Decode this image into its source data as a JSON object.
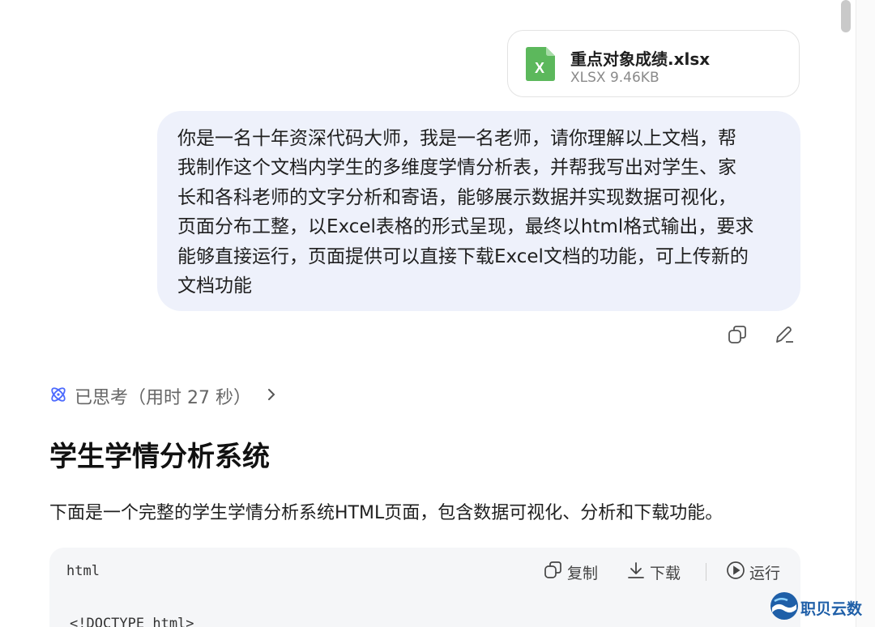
{
  "attachment": {
    "file_name": "重点对象成绩.xlsx",
    "file_meta": "XLSX 9.46KB",
    "icon_letter": "X",
    "icon_color": "#5cb85c"
  },
  "user_message": {
    "lines": [
      "你是一名十年资深代码大师，我是一名老师，请你理解以上文档，帮",
      "我制作这个文档内学生的多维度学情分析表，并帮我写出对学生、家",
      "长和各科老师的文字分析和寄语，能够展示数据并实现数据可视化，",
      "页面分布工整，以Excel表格的形式呈现，最终以html格式输出，要求",
      "能够直接运行，页面提供可以直接下载Excel文档的功能，可上传新的",
      "文档功能"
    ]
  },
  "message_actions": {
    "copy_icon": "copy-icon",
    "edit_icon": "edit-icon"
  },
  "thinking": {
    "label": "已思考（用时 27 秒）",
    "icon": "atom-icon",
    "accent": "#4d6bfe"
  },
  "answer": {
    "title": "学生学情分析系统",
    "intro": "下面是一个完整的学生学情分析系统HTML页面，包含数据可视化、分析和下载功能。"
  },
  "code_block": {
    "language": "html",
    "copy_label": "复制",
    "download_label": "下载",
    "run_label": "运行",
    "first_line": "<!DOCTYPE html>"
  },
  "watermark": {
    "text": "职贝云数"
  }
}
